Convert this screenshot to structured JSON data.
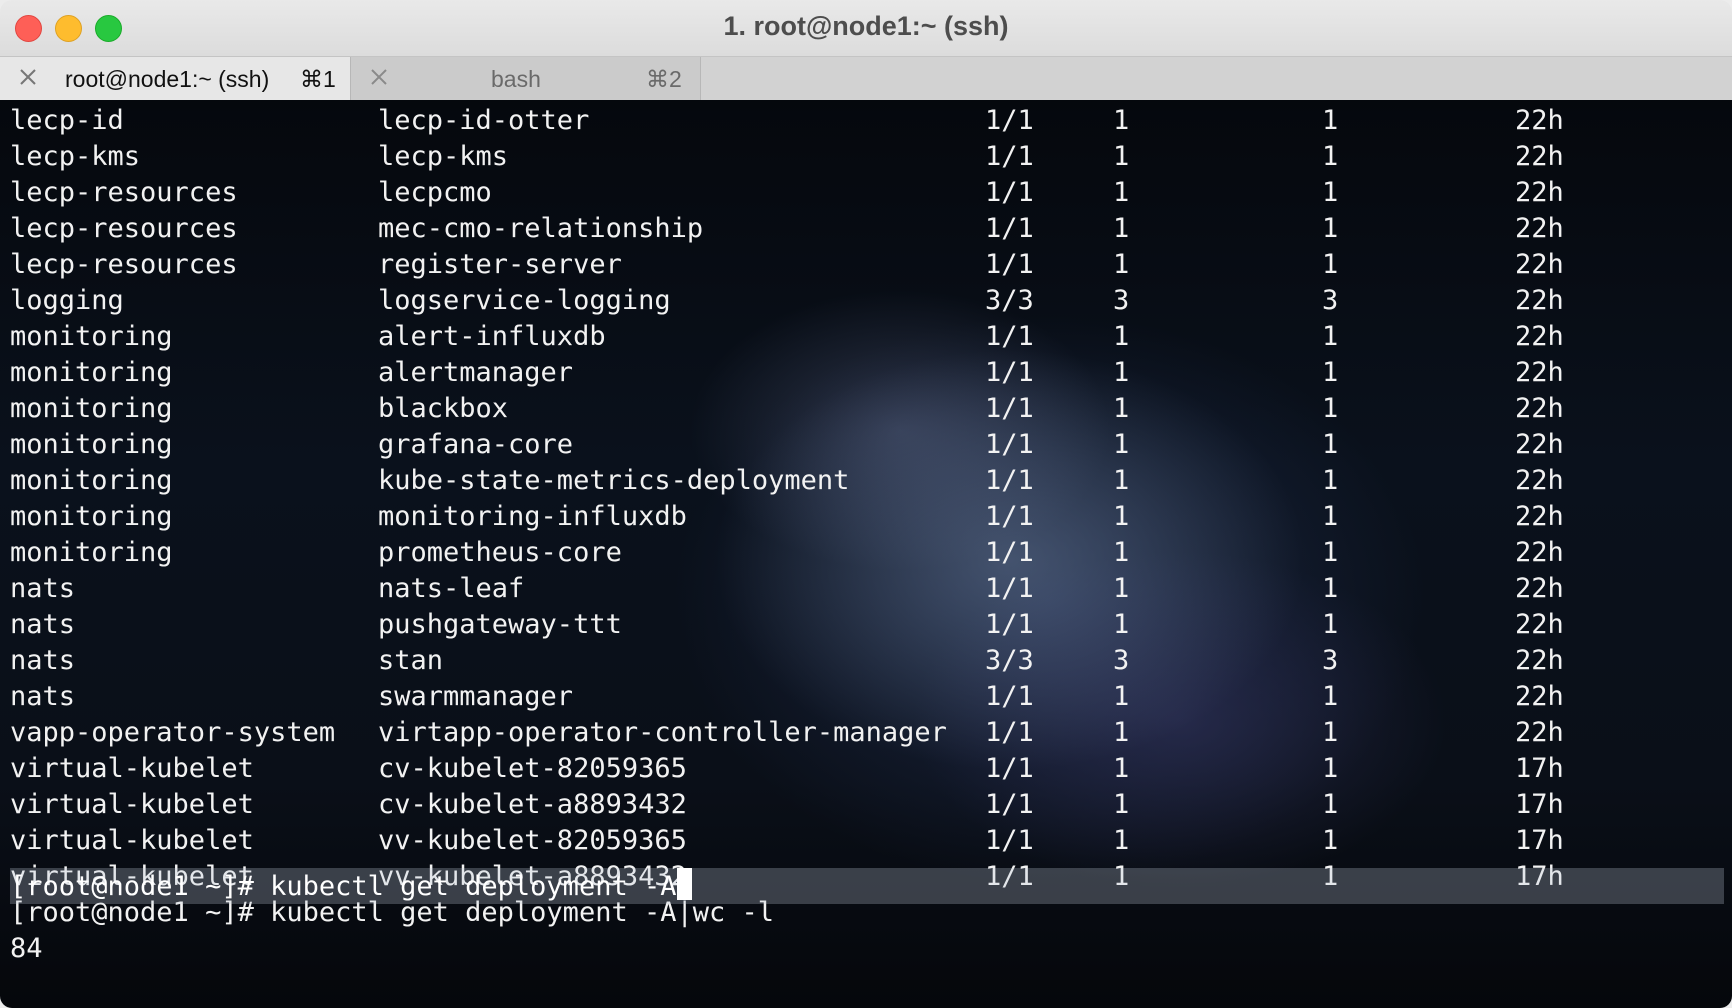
{
  "window": {
    "title": "1. root@node1:~ (ssh)"
  },
  "tabs": [
    {
      "label": "root@node1:~ (ssh)",
      "shortcut": "⌘1",
      "active": true
    },
    {
      "label": "bash",
      "shortcut": "⌘2",
      "active": false
    }
  ],
  "terminal": {
    "rows": [
      [
        "lecp-id",
        "lecp-id-otter",
        "1/1",
        "1",
        "1",
        "22h"
      ],
      [
        "lecp-kms",
        "lecp-kms",
        "1/1",
        "1",
        "1",
        "22h"
      ],
      [
        "lecp-resources",
        "lecpcmo",
        "1/1",
        "1",
        "1",
        "22h"
      ],
      [
        "lecp-resources",
        "mec-cmo-relationship",
        "1/1",
        "1",
        "1",
        "22h"
      ],
      [
        "lecp-resources",
        "register-server",
        "1/1",
        "1",
        "1",
        "22h"
      ],
      [
        "logging",
        "logservice-logging",
        "3/3",
        "3",
        "3",
        "22h"
      ],
      [
        "monitoring",
        "alert-influxdb",
        "1/1",
        "1",
        "1",
        "22h"
      ],
      [
        "monitoring",
        "alertmanager",
        "1/1",
        "1",
        "1",
        "22h"
      ],
      [
        "monitoring",
        "blackbox",
        "1/1",
        "1",
        "1",
        "22h"
      ],
      [
        "monitoring",
        "grafana-core",
        "1/1",
        "1",
        "1",
        "22h"
      ],
      [
        "monitoring",
        "kube-state-metrics-deployment",
        "1/1",
        "1",
        "1",
        "22h"
      ],
      [
        "monitoring",
        "monitoring-influxdb",
        "1/1",
        "1",
        "1",
        "22h"
      ],
      [
        "monitoring",
        "prometheus-core",
        "1/1",
        "1",
        "1",
        "22h"
      ],
      [
        "nats",
        "nats-leaf",
        "1/1",
        "1",
        "1",
        "22h"
      ],
      [
        "nats",
        "pushgateway-ttt",
        "1/1",
        "1",
        "1",
        "22h"
      ],
      [
        "nats",
        "stan",
        "3/3",
        "3",
        "3",
        "22h"
      ],
      [
        "nats",
        "swarmmanager",
        "1/1",
        "1",
        "1",
        "22h"
      ],
      [
        "vapp-operator-system",
        "virtapp-operator-controller-manager",
        "1/1",
        "1",
        "1",
        "22h"
      ],
      [
        "virtual-kubelet",
        "cv-kubelet-82059365",
        "1/1",
        "1",
        "1",
        "17h"
      ],
      [
        "virtual-kubelet",
        "cv-kubelet-a8893432",
        "1/1",
        "1",
        "1",
        "17h"
      ],
      [
        "virtual-kubelet",
        "vv-kubelet-82059365",
        "1/1",
        "1",
        "1",
        "17h"
      ],
      [
        "virtual-kubelet",
        "vv-kubelet-a8893432",
        "1/1",
        "1",
        "1",
        "17h"
      ]
    ],
    "prompt1": "[root@node1 ~]# kubectl get deployment -A|wc -l",
    "output1": "84",
    "prompt2": "[root@node1 ~]# kubectl get deployment -A"
  }
}
